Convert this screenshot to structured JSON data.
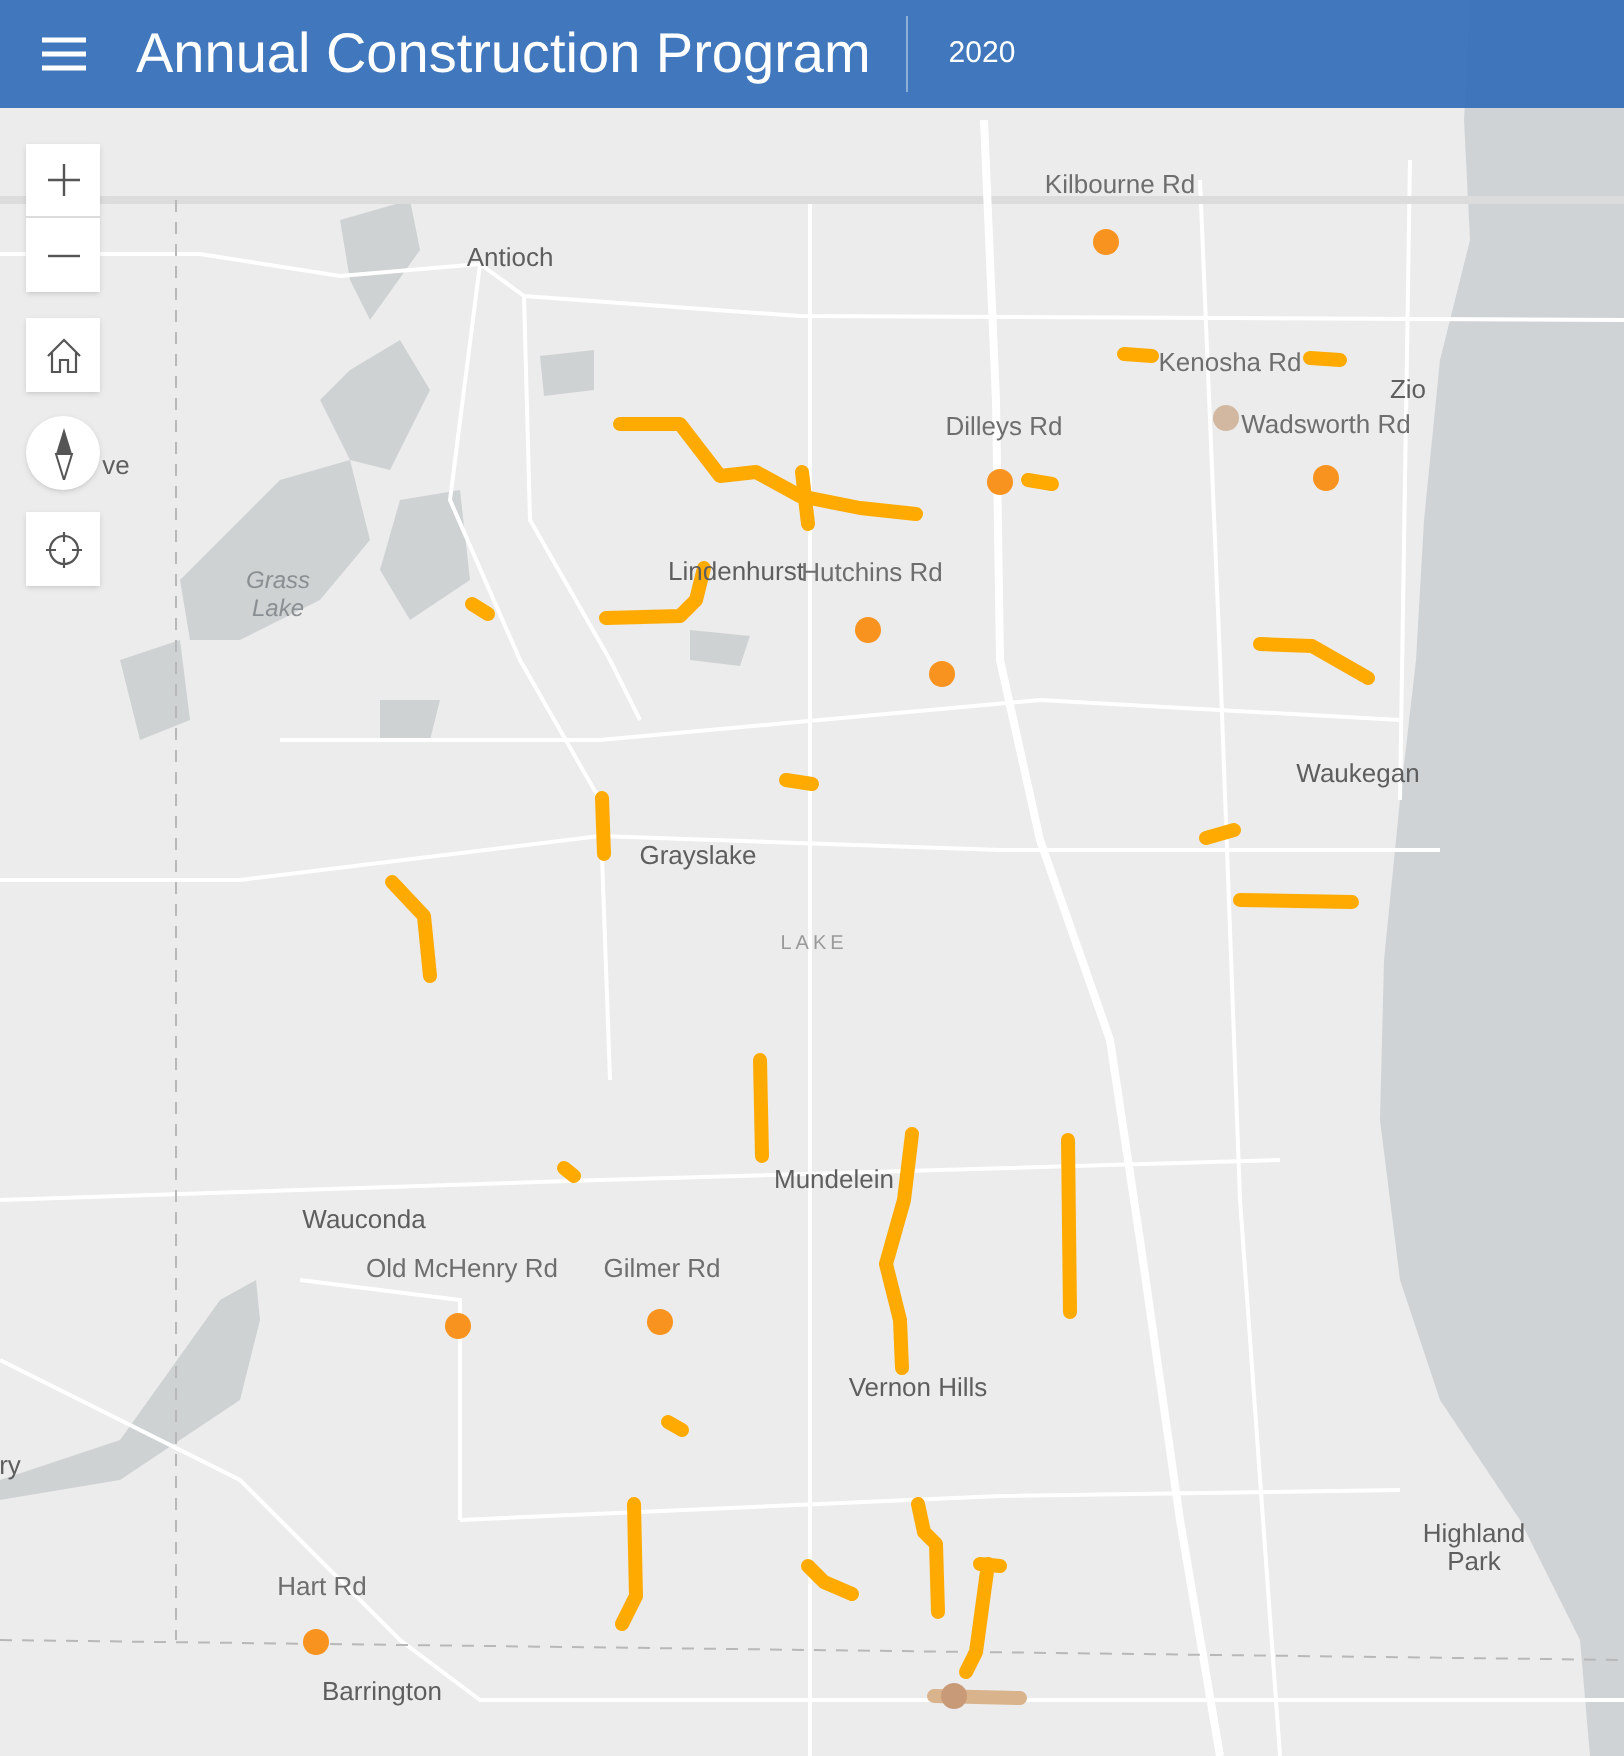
{
  "header": {
    "title": "Annual Construction Program",
    "subtitle": "2020"
  },
  "map_labels": [
    {
      "text": "Kilbourne Rd",
      "kind": "road"
    },
    {
      "text": "Antioch",
      "kind": "place"
    },
    {
      "text": "Kenosha Rd",
      "kind": "road"
    },
    {
      "text": "Dilleys Rd",
      "kind": "road"
    },
    {
      "text": "Zio",
      "kind": "place"
    },
    {
      "text": "Wadsworth Rd",
      "kind": "road"
    },
    {
      "text": "ve",
      "kind": "place"
    },
    {
      "text": "Grass Lake",
      "kind": "water"
    },
    {
      "text": "Lindenhurst",
      "kind": "place"
    },
    {
      "text": "Hutchins Rd",
      "kind": "road"
    },
    {
      "text": "Waukegan",
      "kind": "place"
    },
    {
      "text": "Grayslake",
      "kind": "place"
    },
    {
      "text": "LAKE",
      "kind": "county"
    },
    {
      "text": "Mundelein",
      "kind": "place"
    },
    {
      "text": "Wauconda",
      "kind": "place"
    },
    {
      "text": "Old McHenry Rd",
      "kind": "road"
    },
    {
      "text": "Gilmer Rd",
      "kind": "road"
    },
    {
      "text": "Vernon Hills",
      "kind": "place"
    },
    {
      "text": "ry",
      "kind": "place"
    },
    {
      "text": "Highland Park",
      "kind": "place"
    },
    {
      "text": "Hart Rd",
      "kind": "road"
    },
    {
      "text": "Barrington",
      "kind": "place"
    }
  ],
  "projects": [
    {
      "kind": "line",
      "color": "#ffaa00"
    },
    {
      "kind": "line",
      "color": "#ffaa00"
    },
    {
      "kind": "line",
      "color": "#ffaa00"
    },
    {
      "kind": "line",
      "color": "#ffaa00"
    },
    {
      "kind": "line",
      "color": "#ffaa00"
    },
    {
      "kind": "line",
      "color": "#ffaa00"
    },
    {
      "kind": "line",
      "color": "#ffaa00"
    },
    {
      "kind": "line",
      "color": "#ffaa00"
    },
    {
      "kind": "line",
      "color": "#ffaa00"
    },
    {
      "kind": "line",
      "color": "#ffaa00"
    },
    {
      "kind": "line",
      "color": "#ffaa00"
    },
    {
      "kind": "line",
      "color": "#ffaa00"
    },
    {
      "kind": "line",
      "color": "#ffaa00"
    },
    {
      "kind": "line",
      "color": "#ffaa00"
    },
    {
      "kind": "line",
      "color": "#ffaa00"
    },
    {
      "kind": "line",
      "color": "#ffaa00"
    },
    {
      "kind": "line",
      "color": "#ffaa00"
    },
    {
      "kind": "line",
      "color": "#ffaa00"
    },
    {
      "kind": "line",
      "color": "#ffaa00"
    },
    {
      "kind": "line",
      "color": "#ffaa00"
    },
    {
      "kind": "line",
      "color": "#ffaa00"
    },
    {
      "kind": "line",
      "color": "#ffaa00"
    },
    {
      "kind": "line",
      "color": "#d9b38c"
    },
    {
      "kind": "point",
      "color": "#f7931e"
    },
    {
      "kind": "point",
      "color": "#f7931e"
    },
    {
      "kind": "point",
      "color": "#d2b8a0"
    },
    {
      "kind": "point",
      "color": "#f7931e"
    },
    {
      "kind": "point",
      "color": "#f7931e"
    },
    {
      "kind": "point",
      "color": "#f7931e"
    },
    {
      "kind": "point",
      "color": "#f7931e"
    },
    {
      "kind": "point",
      "color": "#f7931e"
    },
    {
      "kind": "point",
      "color": "#f7931e"
    },
    {
      "kind": "point",
      "color": "#c99a78"
    }
  ]
}
